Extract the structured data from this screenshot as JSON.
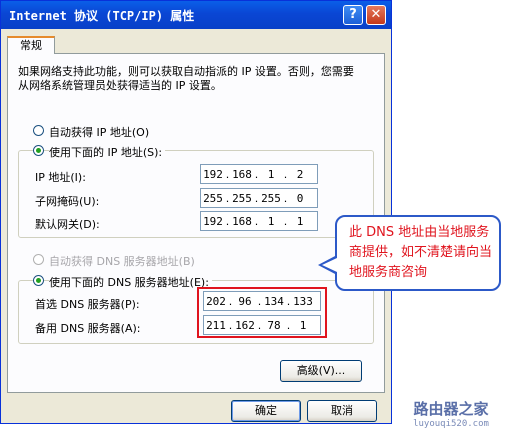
{
  "window": {
    "title": "Internet 协议 (TCP/IP) 属性",
    "help_icon": "question-mark-icon",
    "help_label": "?",
    "close_icon": "close-x-icon",
    "close_label": "✕"
  },
  "tab": {
    "label": "常规"
  },
  "description": "如果网络支持此功能，则可以获取自动指派的 IP 设置。否则，您需要从网络系统管理员处获得适当的 IP 设置。",
  "ip": {
    "auto_option": "自动获得 IP 地址(O)",
    "manual_option": "使用下面的 IP 地址(S):",
    "address_label": "IP 地址(I):",
    "address": [
      "192",
      "168",
      "1",
      "2"
    ],
    "subnet_label": "子网掩码(U):",
    "subnet": [
      "255",
      "255",
      "255",
      "0"
    ],
    "gateway_label": "默认网关(D):",
    "gateway": [
      "192",
      "168",
      "1",
      "1"
    ]
  },
  "dns": {
    "auto_option": "自动获得 DNS 服务器地址(B)",
    "manual_option": "使用下面的 DNS 服务器地址(E):",
    "preferred_label": "首选 DNS 服务器(P):",
    "preferred": [
      "202",
      "96",
      "134",
      "133"
    ],
    "alternate_label": "备用 DNS 服务器(A):",
    "alternate": [
      "211",
      "162",
      "78",
      "1"
    ]
  },
  "buttons": {
    "advanced": "高级(V)...",
    "ok": "确定",
    "cancel": "取消"
  },
  "callout": "此 DNS 地址由当地服务商提供，如不清楚请向当地服务商咨询",
  "watermark": {
    "title": "路由器之家",
    "url": "luyouqi520.com"
  },
  "colors": {
    "titlebar": "#0a46d4",
    "highlight_red": "#e0141e",
    "callout_border": "#2c59c8"
  }
}
